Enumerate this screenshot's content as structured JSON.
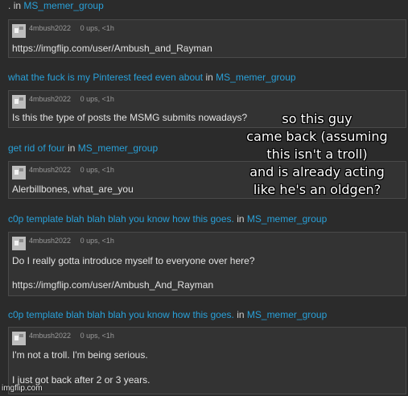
{
  "feed": {
    "posts": [
      {
        "title": ".",
        "in_word": "in",
        "group": "MS_memer_group",
        "comment": {
          "author": "4mbush2022",
          "ups": "0 ups, <1h",
          "lines": [
            "https://imgflip.com/user/Ambush_and_Rayman"
          ]
        }
      },
      {
        "title": "what the fuck is my Pinterest feed even about",
        "in_word": "in",
        "group": "MS_memer_group",
        "comment": {
          "author": "4mbush2022",
          "ups": "0 ups, <1h",
          "lines": [
            "Is this the type of posts the MSMG submits nowadays?"
          ]
        }
      },
      {
        "title": "get rid of four",
        "in_word": "in",
        "group": "MS_memer_group",
        "comment": {
          "author": "4mbush2022",
          "ups": "0 ups, <1h",
          "lines": [
            "Alerbillbones, what_are_you"
          ]
        }
      },
      {
        "title": "c0p template blah blah blah you know how this goes.",
        "in_word": "in",
        "group": "MS_memer_group",
        "comment": {
          "author": "4mbush2022",
          "ups": "0 ups, <1h",
          "lines": [
            "Do I really gotta introduce myself to everyone over here?",
            "https://imgflip.com/user/Ambush_And_Rayman"
          ]
        }
      },
      {
        "title": "c0p template blah blah blah you know how this goes.",
        "in_word": "in",
        "group": "MS_memer_group",
        "comment": {
          "author": "4mbush2022",
          "ups": "0 ups, <1h",
          "lines": [
            "I'm not a troll. I'm being serious.",
            "I just got back after 2 or 3 years."
          ]
        }
      }
    ]
  },
  "overlay": {
    "lines": [
      "so this guy",
      "came back (assuming",
      "this isn't a troll)",
      "and is already acting",
      "like he's an oldgen?"
    ]
  },
  "watermark": "imgflip.com",
  "colors": {
    "background": "#2b2b2b",
    "link": "#29a0d8",
    "box": "#333333"
  },
  "icons": {
    "avatar": "avatar-icon"
  }
}
